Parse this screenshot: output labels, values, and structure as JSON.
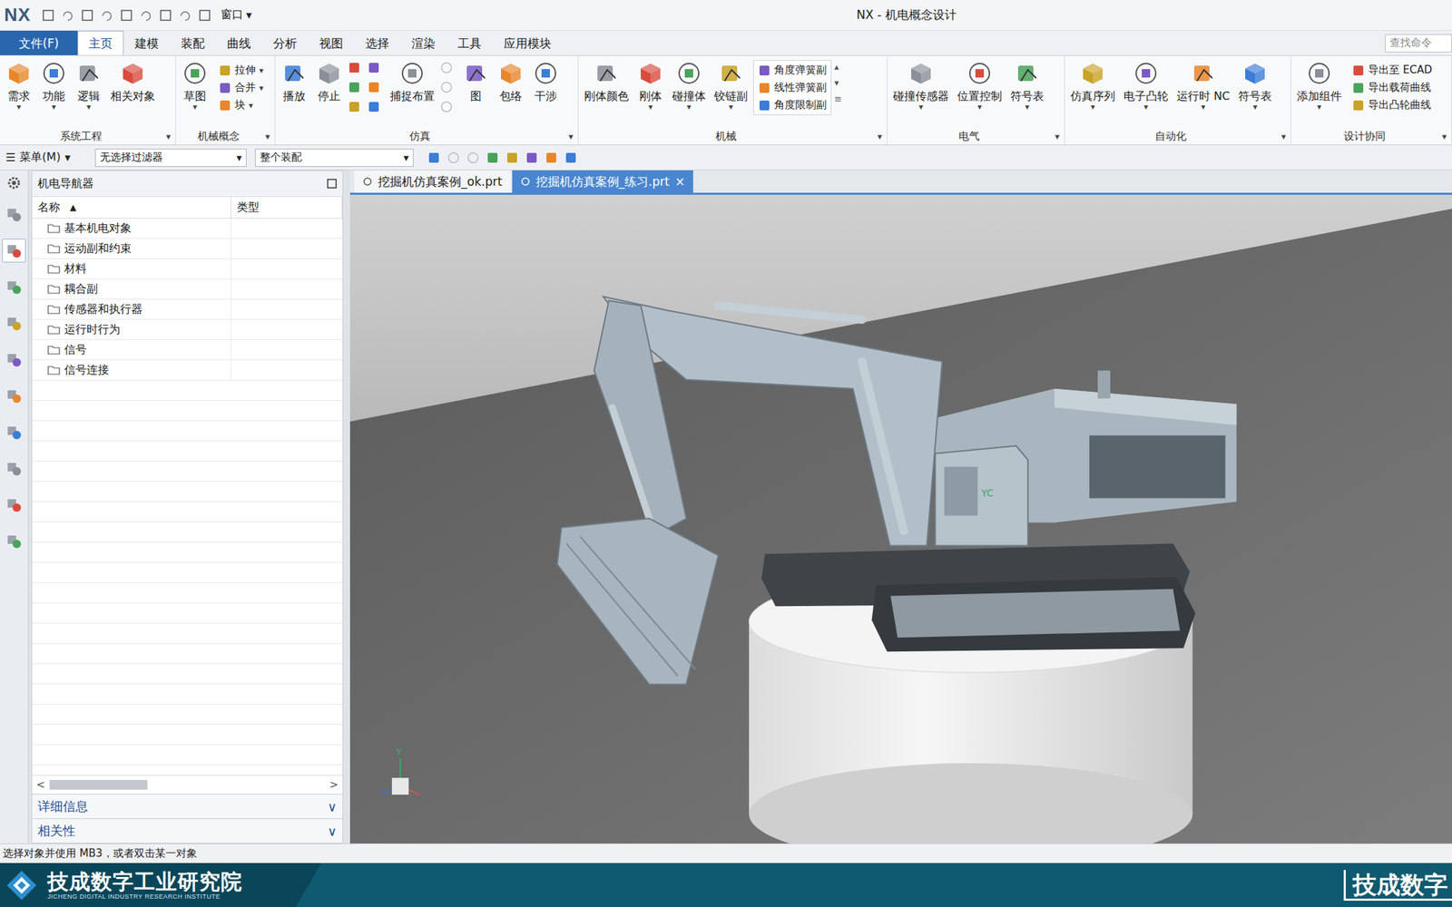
{
  "title_bar": {
    "logo": "NX",
    "window_menu": "窗口",
    "menu_arrow": "▾",
    "title": "NX - 机电概念设计"
  },
  "menu_tabs": [
    {
      "label": "文件(F)",
      "kind": "file",
      "selected": false
    },
    {
      "label": "主页",
      "kind": "tab",
      "selected": true
    },
    {
      "label": "建模",
      "kind": "tab",
      "selected": false
    },
    {
      "label": "装配",
      "kind": "tab",
      "selected": false
    },
    {
      "label": "曲线",
      "kind": "tab",
      "selected": false
    },
    {
      "label": "分析",
      "kind": "tab",
      "selected": false
    },
    {
      "label": "视图",
      "kind": "tab",
      "selected": false
    },
    {
      "label": "选择",
      "kind": "tab",
      "selected": false
    },
    {
      "label": "渲染",
      "kind": "tab",
      "selected": false
    },
    {
      "label": "工具",
      "kind": "tab",
      "selected": false
    },
    {
      "label": "应用模块",
      "kind": "tab",
      "selected": false
    }
  ],
  "search": {
    "placeholder": "查找命令"
  },
  "ribbon": {
    "dropdown_glyph": "▾",
    "group_glyph": "▾",
    "groups": [
      {
        "label": "系统工程",
        "items": [
          {
            "kind": "large",
            "label": "需求",
            "dropdown": true
          },
          {
            "kind": "large",
            "label": "功能",
            "dropdown": true
          },
          {
            "kind": "large",
            "label": "逻辑",
            "dropdown": true
          },
          {
            "kind": "large",
            "label": "相关对象",
            "dropdown": false
          }
        ]
      },
      {
        "label": "机械概念",
        "items": [
          {
            "kind": "large",
            "label": "草图",
            "dropdown": true
          },
          {
            "kind": "stack",
            "boxed": false,
            "entries": [
              {
                "label": "拉伸",
                "dropdown": true
              },
              {
                "label": "合并",
                "dropdown": true
              },
              {
                "label": "块",
                "dropdown": true
              }
            ]
          }
        ]
      },
      {
        "label": "仿真",
        "items": [
          {
            "kind": "large",
            "label": "播放",
            "dropdown": false
          },
          {
            "kind": "large",
            "label": "停止",
            "dropdown": false
          },
          {
            "kind": "icons",
            "buttons": [
              {
                "disabled": false
              },
              {
                "disabled": false
              },
              {
                "disabled": false
              },
              {
                "disabled": false
              },
              {
                "disabled": false
              },
              {
                "disabled": false
              }
            ]
          },
          {
            "kind": "large",
            "label": "捕捉布置",
            "dropdown": false
          },
          {
            "kind": "icons",
            "buttons": [
              {
                "disabled": true
              },
              {
                "disabled": true
              },
              {
                "disabled": true
              }
            ]
          },
          {
            "kind": "large",
            "label": "图",
            "dropdown": false
          },
          {
            "kind": "large",
            "label": "包络",
            "dropdown": false
          },
          {
            "kind": "large",
            "label": "干涉",
            "dropdown": false
          }
        ]
      },
      {
        "label": "机械",
        "items": [
          {
            "kind": "large",
            "label": "刚体颜色",
            "dropdown": false
          },
          {
            "kind": "large",
            "label": "刚体",
            "dropdown": true
          },
          {
            "kind": "large",
            "label": "碰撞体",
            "dropdown": true
          },
          {
            "kind": "large",
            "label": "铰链副",
            "dropdown": true
          },
          {
            "kind": "stack",
            "boxed": true,
            "entries": [
              {
                "label": "角度弹簧副",
                "dropdown": false
              },
              {
                "label": "线性弹簧副",
                "dropdown": false
              },
              {
                "label": "角度限制副",
                "dropdown": false
              }
            ]
          },
          {
            "kind": "scroll",
            "glyphs": [
              "▴",
              "▾",
              "≡"
            ]
          }
        ]
      },
      {
        "label": "电气",
        "items": [
          {
            "kind": "large",
            "label": "碰撞传感器",
            "dropdown": true
          },
          {
            "kind": "large",
            "label": "位置控制",
            "dropdown": true
          },
          {
            "kind": "large",
            "label": "符号表",
            "dropdown": true
          }
        ]
      },
      {
        "label": "自动化",
        "items": [
          {
            "kind": "large",
            "label": "仿真序列",
            "dropdown": true
          },
          {
            "kind": "large",
            "label": "电子凸轮",
            "dropdown": true
          },
          {
            "kind": "large",
            "label": "运行时 NC",
            "dropdown": true
          },
          {
            "kind": "large",
            "label": "符号表",
            "dropdown": true
          }
        ]
      },
      {
        "label": "设计协同",
        "items": [
          {
            "kind": "large",
            "label": "添加组件",
            "dropdown": true
          },
          {
            "kind": "stack",
            "boxed": false,
            "entries": [
              {
                "label": "导出至 ECAD",
                "dropdown": false
              },
              {
                "label": "导出载荷曲线",
                "dropdown": false
              },
              {
                "label": "导出凸轮曲线",
                "dropdown": false
              }
            ]
          }
        ]
      }
    ]
  },
  "selection_bar": {
    "menu_glyph": "☰",
    "menu": "菜单(M)",
    "dropdown_glyph": "▾",
    "filter": "无选择过滤器",
    "scope": "整个装配"
  },
  "icon_strip": [
    {
      "selected": false
    },
    {
      "selected": true
    },
    {
      "selected": false
    },
    {
      "selected": false
    },
    {
      "selected": false
    },
    {
      "selected": false
    },
    {
      "selected": false
    },
    {
      "selected": false
    },
    {
      "selected": false
    },
    {
      "selected": false
    }
  ],
  "navigator": {
    "title": "机电导航器",
    "columns": [
      {
        "label": "名称",
        "sort": "▲"
      },
      {
        "label": "类型",
        "sort": ""
      }
    ],
    "rows": [
      "基本机电对象",
      "运动副和约束",
      "材料",
      "耦合副",
      "传感器和执行器",
      "运行时行为",
      "信号",
      "信号连接"
    ],
    "scroll_left": "<",
    "scroll_right": ">",
    "sections": [
      {
        "label": "详细信息",
        "expanded": false,
        "glyph": "∨"
      },
      {
        "label": "相关性",
        "expanded": false,
        "glyph": "∨"
      }
    ]
  },
  "documents": [
    {
      "label": "挖掘机仿真案例_ok.prt",
      "selected": false
    },
    {
      "label": "挖掘机仿真案例_练习.prt",
      "selected": true
    }
  ],
  "close_glyph": "×",
  "viewport": {
    "csys_label": "YC",
    "triad_label": "Y"
  },
  "status_bar": "选择对象并使用 MB3，或者双击某一对象",
  "banner": {
    "name": "技成数字工业研究院",
    "subtitle": "JICHENG DIGITAL INDUSTRY RESEARCH INSTITUTE",
    "right": "技成数字"
  }
}
